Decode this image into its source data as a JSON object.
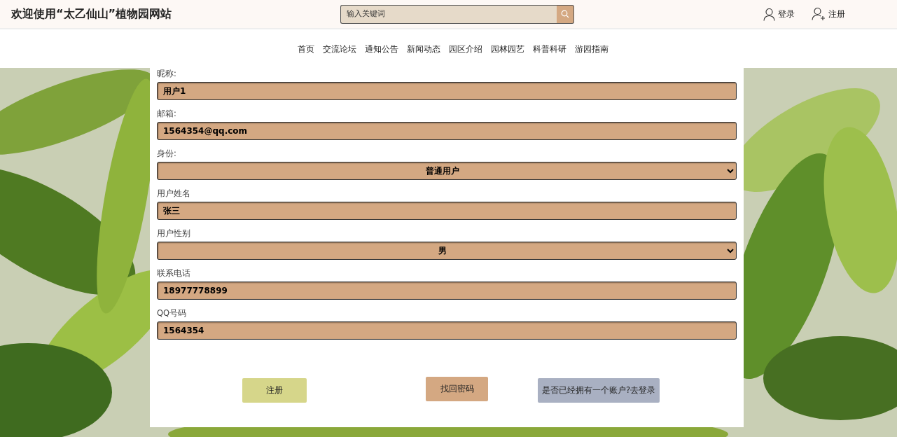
{
  "header": {
    "title": "欢迎使用“太乙仙山”植物园网站",
    "search": {
      "placeholder": "输入关键词"
    },
    "links": [
      {
        "label": "登录",
        "kind": "user"
      },
      {
        "label": "注册",
        "kind": "user-add"
      }
    ]
  },
  "nav": [
    "首页",
    "交流论坛",
    "通知公告",
    "新闻动态",
    "园区介绍",
    "园林园艺",
    "科普科研",
    "游园指南"
  ],
  "form": {
    "fields": [
      {
        "label": "昵称:",
        "kind": "input",
        "value": "用户1"
      },
      {
        "label": "邮箱:",
        "kind": "input",
        "value": "1564354@qq.com"
      },
      {
        "label": "身份:",
        "kind": "select",
        "value": "普通用户"
      },
      {
        "label": "用户姓名",
        "kind": "input",
        "value": "张三"
      },
      {
        "label": "用户性别",
        "kind": "select",
        "value": "男"
      },
      {
        "label": "联系电话",
        "kind": "input",
        "value": "18977778899"
      },
      {
        "label": "QQ号码",
        "kind": "input",
        "value": "1564354"
      }
    ],
    "buttons": [
      {
        "label": "注册",
        "color": "#d6d68a"
      },
      {
        "label": "找回密码",
        "color": "#d4a882"
      },
      {
        "label": "是否已经拥有一个账户?去登录",
        "color": "#a9b0c2"
      }
    ]
  }
}
